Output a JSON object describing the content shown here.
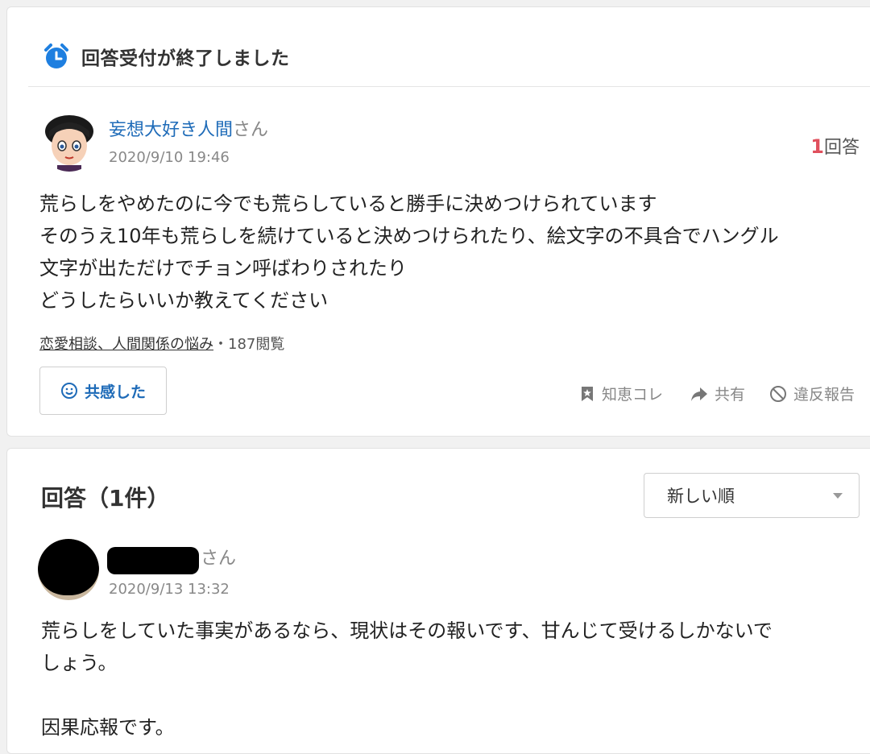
{
  "question": {
    "status_text": "回答受付が終了しました",
    "user": {
      "name": "妄想大好き人間",
      "suffix": "さん",
      "date": "2020/9/10 19:46"
    },
    "answer_count": {
      "number": "1",
      "label": "回答"
    },
    "body": "荒らしをやめたのに今でも荒らしていると勝手に決めつけられています\nそのうえ10年も荒らしを続けていると決めつけられたり、絵文字の不具合でハングル\n文字が出ただけでチョン呼ばわりされたり\nどうしたらいいか教えてください",
    "category": "恋愛相談、人間関係の悩み",
    "views": "・187閲覧",
    "empathy_label": "共感した",
    "actions": {
      "chiebukuro": "知恵コレ",
      "share": "共有",
      "report": "違反報告"
    }
  },
  "answers": {
    "title": "回答（1件）",
    "sort": {
      "selected": "新しい順"
    },
    "items": [
      {
        "name_suffix": "さん",
        "date": "2020/9/13 13:32",
        "body": "荒らしをしていた事実があるなら、現状はその報いです、甘んじて受けるしかないで\nしょう。\n\n因果応報です。"
      }
    ]
  },
  "colors": {
    "accent": "#1e6bb8",
    "count": "#e0505d",
    "muted": "#888888"
  },
  "icons": [
    "alarm-clock-icon",
    "smile-icon",
    "bookmark-icon",
    "share-arrow-icon",
    "prohibit-icon",
    "chevron-down-icon"
  ]
}
